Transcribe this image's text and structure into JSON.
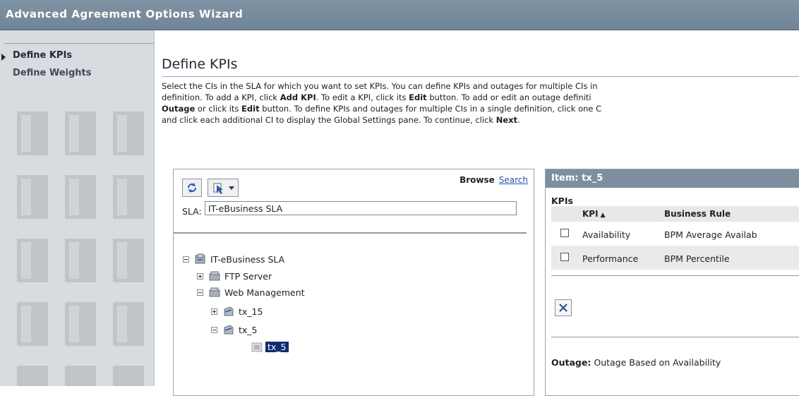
{
  "window": {
    "title": "Advanced Agreement Options Wizard"
  },
  "nav": {
    "items": [
      {
        "label": "Define KPIs",
        "active": true
      },
      {
        "label": "Define Weights",
        "active": false
      }
    ]
  },
  "main": {
    "title": "Define KPIs",
    "desc": {
      "l1": "Select the CIs in the SLA for which you want to set KPIs. You can define KPIs and outages for multiple CIs in",
      "l2a": "definition. To add a KPI, click ",
      "l2b": "Add KPI",
      "l2c": ". To edit a KPI, click its ",
      "l2d": "Edit",
      "l2e": " button. To add or edit an outage definiti",
      "l3a": "Outage",
      "l3b": " or click its ",
      "l3c": "Edit",
      "l3d": " button. To define KPIs and outages for multiple CIs in a single definition, click one C",
      "l4a": "and click each additional CI to display the Global Settings pane. To continue, click ",
      "l4b": "Next",
      "l4c": "."
    }
  },
  "browser": {
    "browse_label": "Browse",
    "search_label": "Search",
    "sla_label": "SLA:",
    "sla_value": "IT-eBusiness SLA",
    "tree": [
      {
        "label": "IT-eBusiness SLA",
        "expander": "minus",
        "icon": "sla-icon"
      },
      {
        "label": "FTP Server",
        "expander": "plus",
        "icon": "group-icon"
      },
      {
        "label": "Web Management",
        "expander": "minus",
        "icon": "group-icon"
      },
      {
        "label": "tx_15",
        "expander": "plus",
        "icon": "transaction-icon"
      },
      {
        "label": "tx_5",
        "expander": "minus",
        "icon": "transaction-icon"
      },
      {
        "label": "tx_5",
        "expander": "none",
        "icon": "transaction-leaf-icon",
        "selected": true
      }
    ]
  },
  "detail": {
    "header": "Item: tx_5",
    "kpis_label": "KPIs",
    "columns": {
      "kpi": "KPI",
      "rule": "Business Rule"
    },
    "sort_indicator": "▲",
    "rows": [
      {
        "kpi": "Availability",
        "rule": "BPM Average Availab"
      },
      {
        "kpi": "Performance",
        "rule": "BPM Percentile"
      }
    ],
    "outage_label": "Outage:",
    "outage_value": "Outage Based on Availability"
  },
  "colors": {
    "titlebar": "#7f93a3",
    "panel_header": "#7d8f9f",
    "selection": "#0f2d6e",
    "link": "#2255aa"
  }
}
